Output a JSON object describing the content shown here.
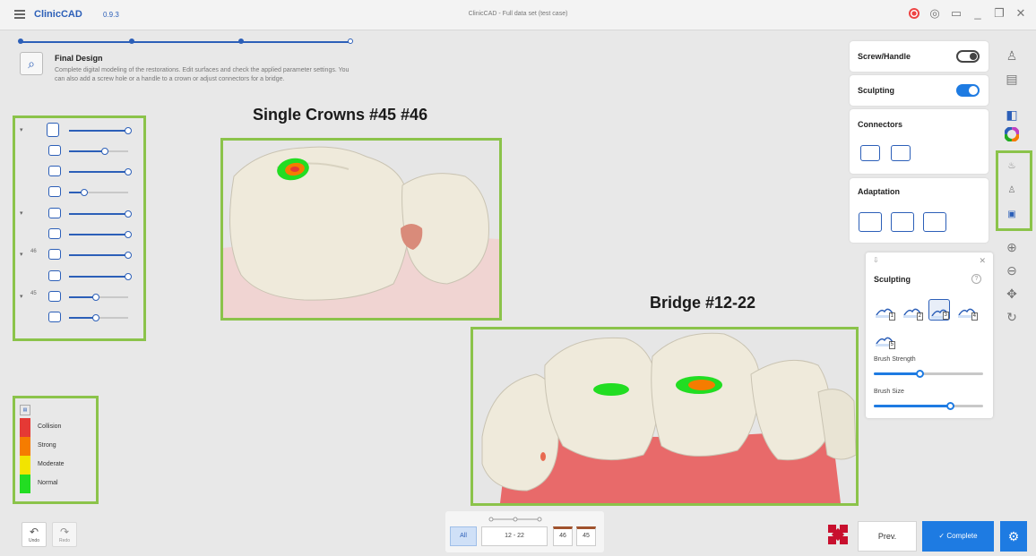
{
  "titlebar": {
    "app_name": "ClinicCAD",
    "app_version": "0.9.3",
    "window_title": "ClinicCAD - Full data set (test case)",
    "minimize_glyph": "_",
    "restore_glyph": "❐",
    "close_glyph": "✕"
  },
  "stage": {
    "title": "Final Design",
    "description": "Complete digital modeling of the restorations. Edit surfaces and check the applied parameter settings. You can also add a screw hole or a handle to a crown or adjust connectors for a bridge."
  },
  "layer_sliders": [
    {
      "icon": "jaw-icon",
      "expandable": true,
      "number": "",
      "level": 1.0
    },
    {
      "icon": "crown-layer-icon",
      "expandable": false,
      "number": "",
      "level": 0.6
    },
    {
      "icon": "bridge-layer-icon",
      "expandable": false,
      "number": "",
      "level": 1.0
    },
    {
      "icon": "antagonist-icon",
      "expandable": false,
      "number": "",
      "level": 0.25
    },
    {
      "icon": "bridge-group-icon",
      "expandable": true,
      "number": "",
      "level": 1.0
    },
    {
      "icon": "bridge-connector-icon",
      "expandable": false,
      "number": "",
      "level": 1.0
    },
    {
      "icon": "tooth-icon",
      "expandable": true,
      "number": "46",
      "level": 1.0
    },
    {
      "icon": "crown-icon",
      "expandable": false,
      "number": "",
      "level": 1.0
    },
    {
      "icon": "tooth-icon",
      "expandable": true,
      "number": "45",
      "level": 0.45
    },
    {
      "icon": "crown-icon",
      "expandable": false,
      "number": "",
      "level": 0.45
    }
  ],
  "legend": {
    "items": [
      {
        "label": "Collision",
        "color": "#e53935"
      },
      {
        "label": "Strong",
        "color": "#f57c00"
      },
      {
        "label": "Moderate",
        "color": "#f2e400"
      },
      {
        "label": "Normal",
        "color": "#22dd22"
      }
    ]
  },
  "views": {
    "crowns_heading": "Single Crowns #45 #46",
    "bridge_heading": "Bridge #12-22"
  },
  "panels": {
    "screw_handle": {
      "label": "Screw/Handle",
      "enabled": false
    },
    "sculpting": {
      "label": "Sculpting",
      "enabled": true
    },
    "connectors": {
      "label": "Connectors"
    },
    "adaptation": {
      "label": "Adaptation"
    }
  },
  "sculpt_panel": {
    "title": "Sculpting",
    "help": "?",
    "brushes": [
      "1",
      "2",
      "3",
      "4",
      "5"
    ],
    "active_brush": "3",
    "brush_strength_label": "Brush Strength",
    "brush_strength": 0.42,
    "brush_size_label": "Brush Size",
    "brush_size": 0.7
  },
  "bottom": {
    "undo_label": "Undo",
    "redo_label": "Redo",
    "filter_all": "All",
    "filter_bridge": "12 - 22",
    "filter_tooth_1": "46",
    "filter_tooth_2": "45",
    "prev_label": "Prev.",
    "complete_label": "✓ Complete"
  },
  "colors": {
    "accent": "#1e7be2",
    "highlight_box": "#8bc34a",
    "tooth": "#efeadb",
    "gum": "#e86a6a"
  }
}
